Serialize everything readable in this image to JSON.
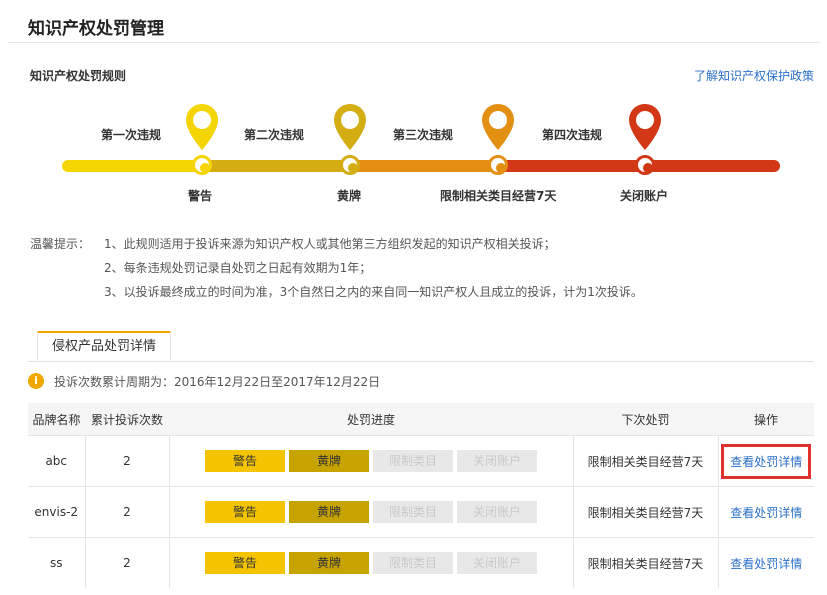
{
  "page_title": "知识产权处罚管理",
  "rules": {
    "title": "知识产权处罚规则",
    "policy_link": "了解知识产权保护政策",
    "steps": [
      {
        "violation": "第一次违规",
        "result": "警告",
        "color": "#f5d500"
      },
      {
        "violation": "第二次违规",
        "result": "黄牌",
        "color": "#d3ad12"
      },
      {
        "violation": "第三次违规",
        "result": "限制相关类目经营7天",
        "color": "#e39012"
      },
      {
        "violation": "第四次违规",
        "result": "关闭账户",
        "color": "#d23716"
      }
    ]
  },
  "tips": {
    "title": "温馨提示：",
    "items": [
      "1、此规则适用于投诉来源为知识产权人或其他第三方组织发起的知识产权相关投诉；",
      "2、每条违规处罚记录自处罚之日起有效期为1年；",
      "3、以投诉最终成立的时间为准，3个自然日之内的来自同一知识产权人且成立的投诉，计为1次投诉。"
    ]
  },
  "tab": {
    "label": "侵权产品处罚详情"
  },
  "period": {
    "icon": "info-icon",
    "text": "投诉次数累计周期为：2016年12月22日至2017年12月22日"
  },
  "table": {
    "headers": [
      "品牌名称",
      "累计投诉次数",
      "处罚进度",
      "下次处罚",
      "操作"
    ],
    "progress_labels": [
      "警告",
      "黄牌",
      "限制类目",
      "关闭账户"
    ],
    "rows": [
      {
        "brand": "abc",
        "count": "2",
        "next": "限制相关类目经营7天",
        "action": "查看处罚详情"
      },
      {
        "brand": "envis-2",
        "count": "2",
        "next": "限制相关类目经营7天",
        "action": "查看处罚详情"
      },
      {
        "brand": "ss",
        "count": "2",
        "next": "限制相关类目经营7天",
        "action": "查看处罚详情"
      }
    ]
  }
}
